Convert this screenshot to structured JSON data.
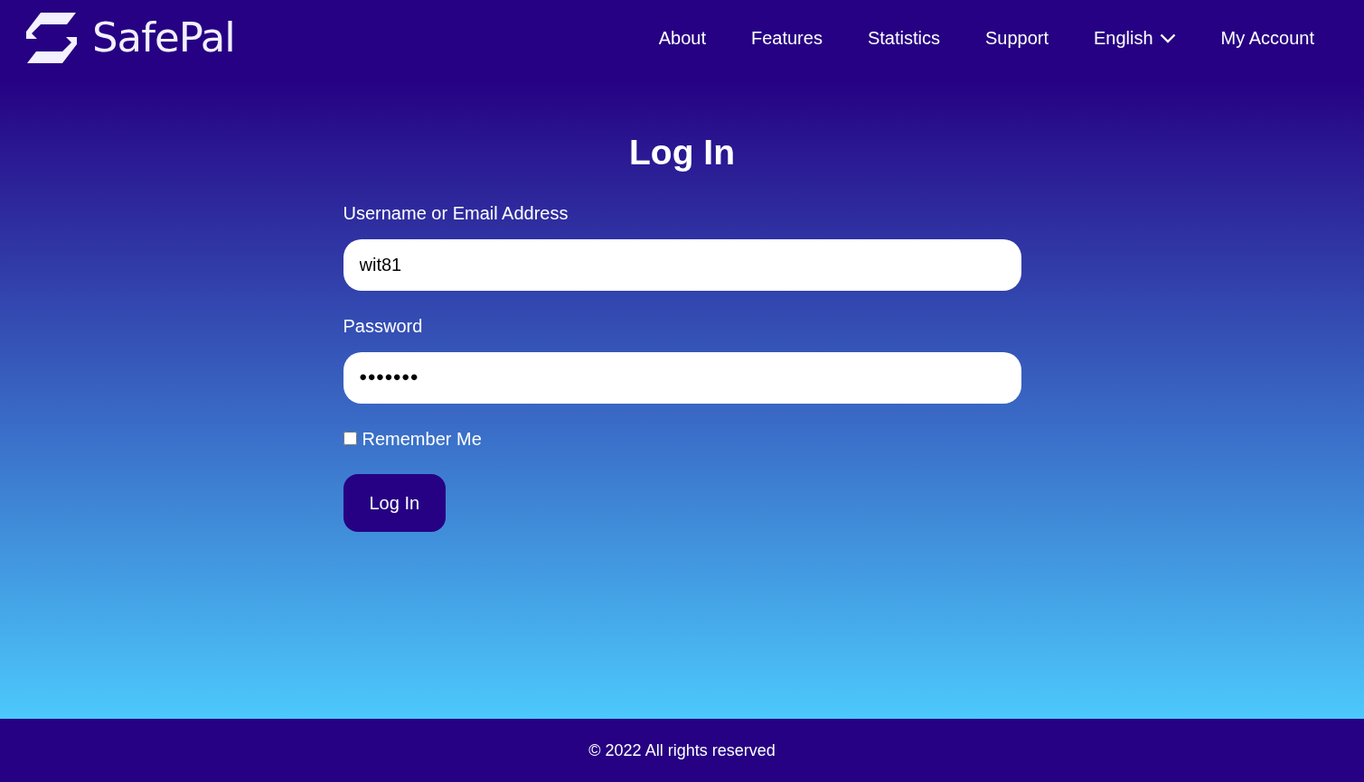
{
  "brand": {
    "name": "SafePal"
  },
  "nav": [
    {
      "label": "About",
      "dropdown": false
    },
    {
      "label": "Features",
      "dropdown": false
    },
    {
      "label": "Statistics",
      "dropdown": false
    },
    {
      "label": "Support",
      "dropdown": false
    },
    {
      "label": "English",
      "dropdown": true
    },
    {
      "label": "My Account",
      "dropdown": false
    }
  ],
  "form": {
    "title": "Log In",
    "fields": [
      {
        "label": "Username or Email Address",
        "value": "wit81"
      },
      {
        "label": "Password",
        "value": "•••••••"
      }
    ],
    "remember": {
      "label": "Remember Me",
      "checked": false
    },
    "submit": "Log In"
  },
  "footer": {
    "text": "© 2022 All rights reserved"
  }
}
